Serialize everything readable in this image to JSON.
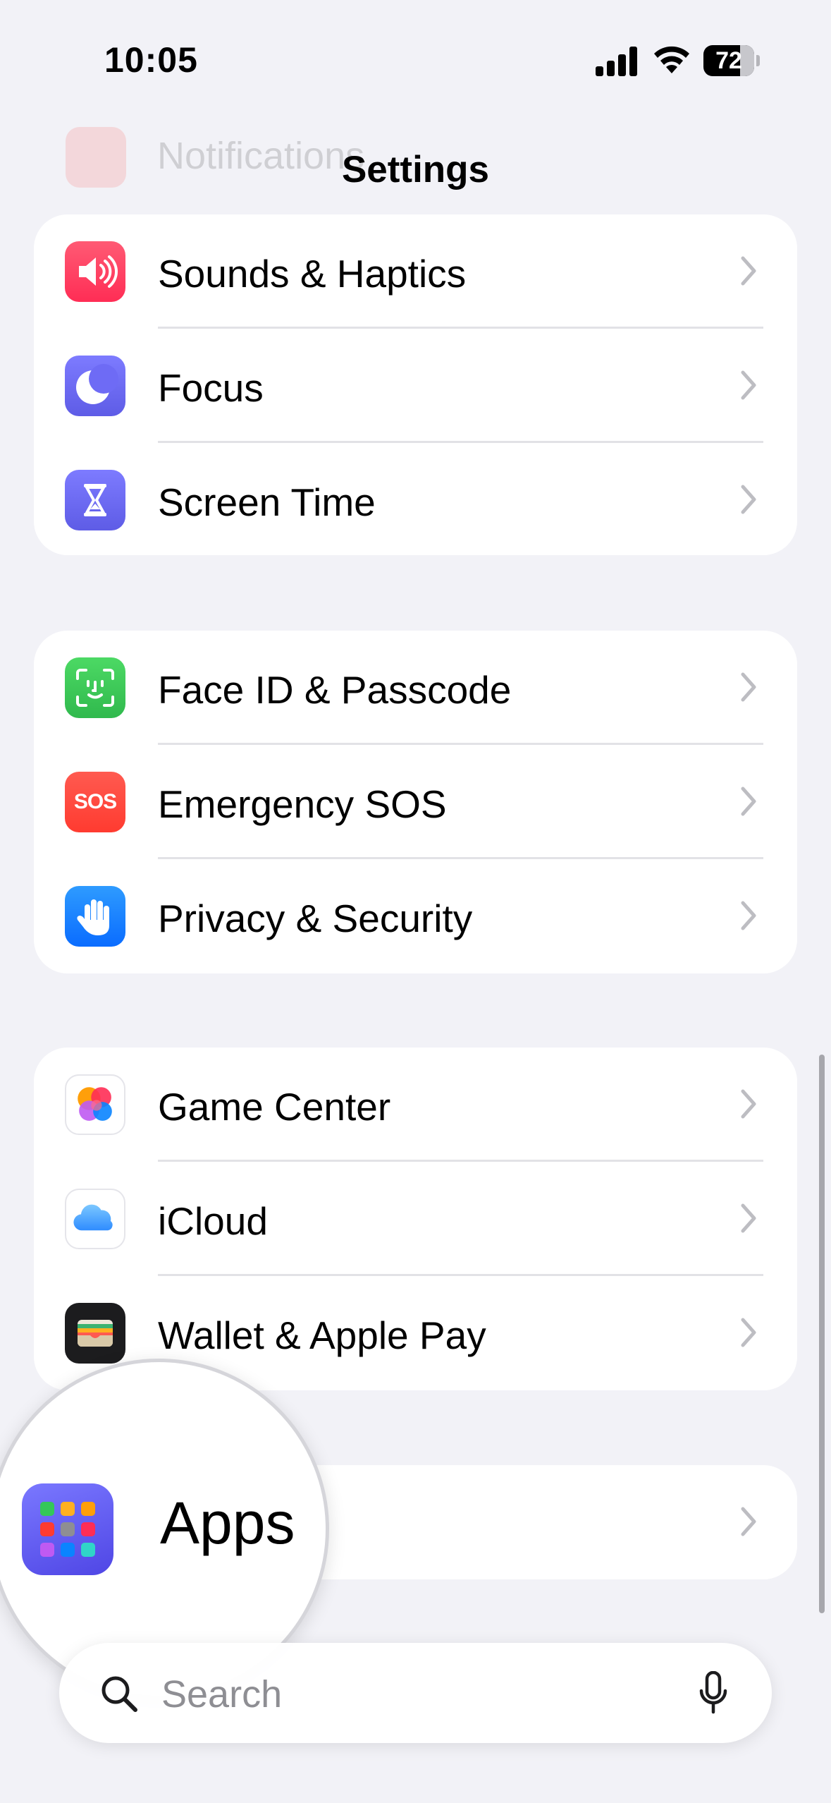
{
  "status_bar": {
    "time": "10:05",
    "battery_level": "72",
    "battery_fraction": 0.72
  },
  "nav": {
    "title": "Settings",
    "faded_item": "Notifications"
  },
  "groups": [
    {
      "items": [
        {
          "label": "Sounds & Haptics",
          "icon": "speaker-icon",
          "color": "#FF2D55"
        },
        {
          "label": "Focus",
          "icon": "moon-icon",
          "color": "#5E5CE6"
        },
        {
          "label": "Screen Time",
          "icon": "hourglass-icon",
          "color": "#5E5CE6"
        }
      ]
    },
    {
      "items": [
        {
          "label": "Face ID & Passcode",
          "icon": "face-id-icon",
          "color": "#34C759"
        },
        {
          "label": "Emergency SOS",
          "icon": "sos-icon",
          "color": "#FF3B30",
          "icon_text": "SOS"
        },
        {
          "label": "Privacy & Security",
          "icon": "hand-icon",
          "color": "#0A84FF"
        }
      ]
    },
    {
      "items": [
        {
          "label": "Game Center",
          "icon": "game-center-icon",
          "color": "#FFFFFF"
        },
        {
          "label": "iCloud",
          "icon": "cloud-icon",
          "color": "#FFFFFF"
        },
        {
          "label": "Wallet & Apple Pay",
          "icon": "wallet-icon",
          "color": "#1C1C1E"
        }
      ]
    },
    {
      "items": [
        {
          "label": "Apps",
          "icon": "apps-icon",
          "color": "#5E5CE6"
        }
      ]
    }
  ],
  "search": {
    "placeholder": "Search"
  }
}
